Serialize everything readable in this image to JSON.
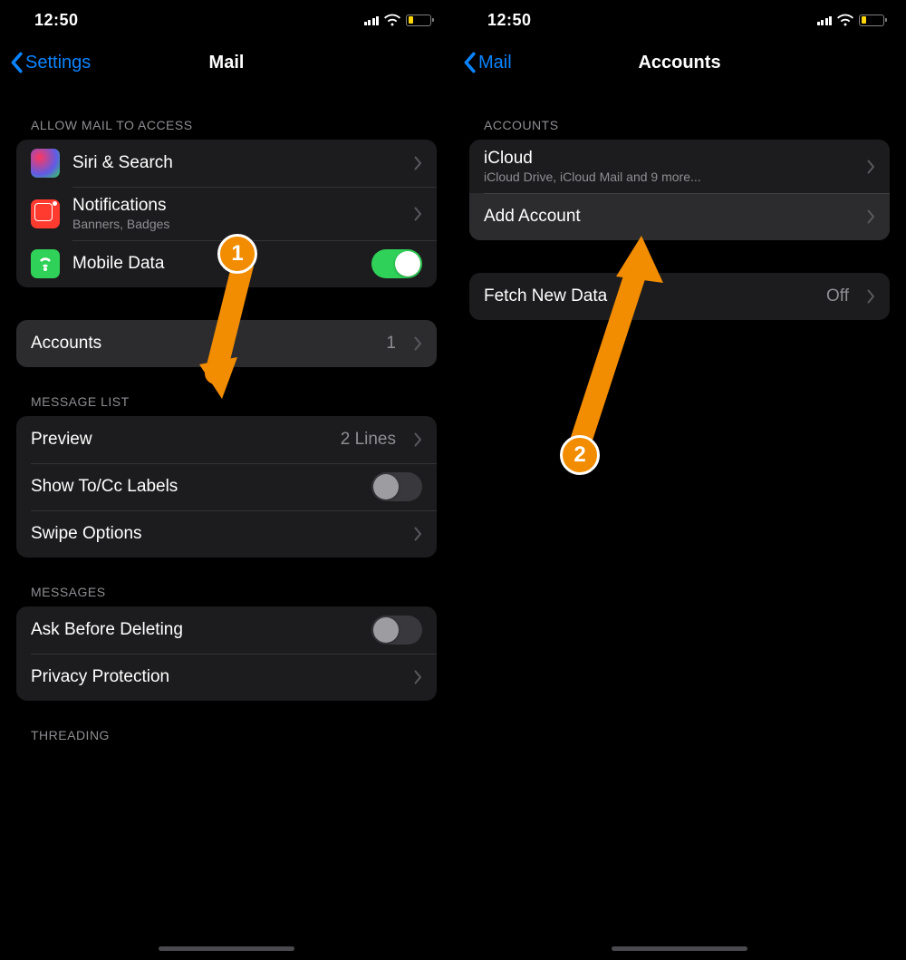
{
  "status": {
    "time": "12:50"
  },
  "left": {
    "back_label": "Settings",
    "title": "Mail",
    "sections": {
      "allow_access": {
        "header": "ALLOW MAIL TO ACCESS",
        "siri": "Siri & Search",
        "notifications": {
          "title": "Notifications",
          "sub": "Banners, Badges"
        },
        "mobile_data": "Mobile Data"
      },
      "accounts": {
        "label": "Accounts",
        "count": "1"
      },
      "message_list": {
        "header": "MESSAGE LIST",
        "preview": {
          "label": "Preview",
          "value": "2 Lines"
        },
        "show_tocc": "Show To/Cc Labels",
        "swipe": "Swipe Options"
      },
      "messages": {
        "header": "MESSAGES",
        "ask_delete": "Ask Before Deleting",
        "privacy": "Privacy Protection"
      },
      "threading": {
        "header": "THREADING"
      }
    }
  },
  "right": {
    "back_label": "Mail",
    "title": "Accounts",
    "sections": {
      "accounts": {
        "header": "ACCOUNTS",
        "icloud": {
          "title": "iCloud",
          "sub": "iCloud Drive, iCloud Mail and 9 more..."
        },
        "add": "Add Account"
      },
      "fetch": {
        "label": "Fetch New Data",
        "value": "Off"
      }
    }
  },
  "annotations": {
    "badge1": "1",
    "badge2": "2"
  }
}
